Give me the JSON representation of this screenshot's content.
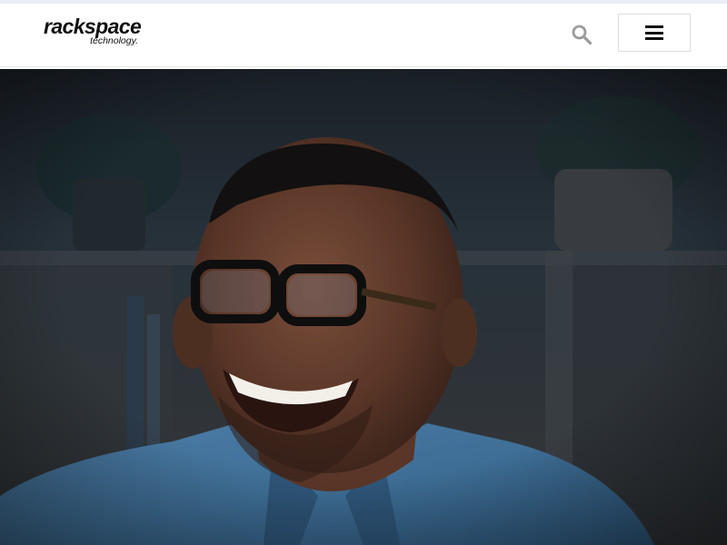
{
  "brand": {
    "logo_main": "rackspace",
    "logo_sub": "technology."
  },
  "header": {
    "search_icon": "search-icon",
    "menu_icon": "hamburger-menu-icon"
  },
  "hero": {
    "image_subject": "smiling man with glasses wearing a denim shirt in a dim room"
  },
  "colors": {
    "header_bg": "#ffffff",
    "top_accent": "#e9eef5",
    "search_icon": "#9b9b9b",
    "menu_icon": "#111111",
    "hero_shirt": "#3f6f97",
    "hero_background": "#1b2127"
  }
}
